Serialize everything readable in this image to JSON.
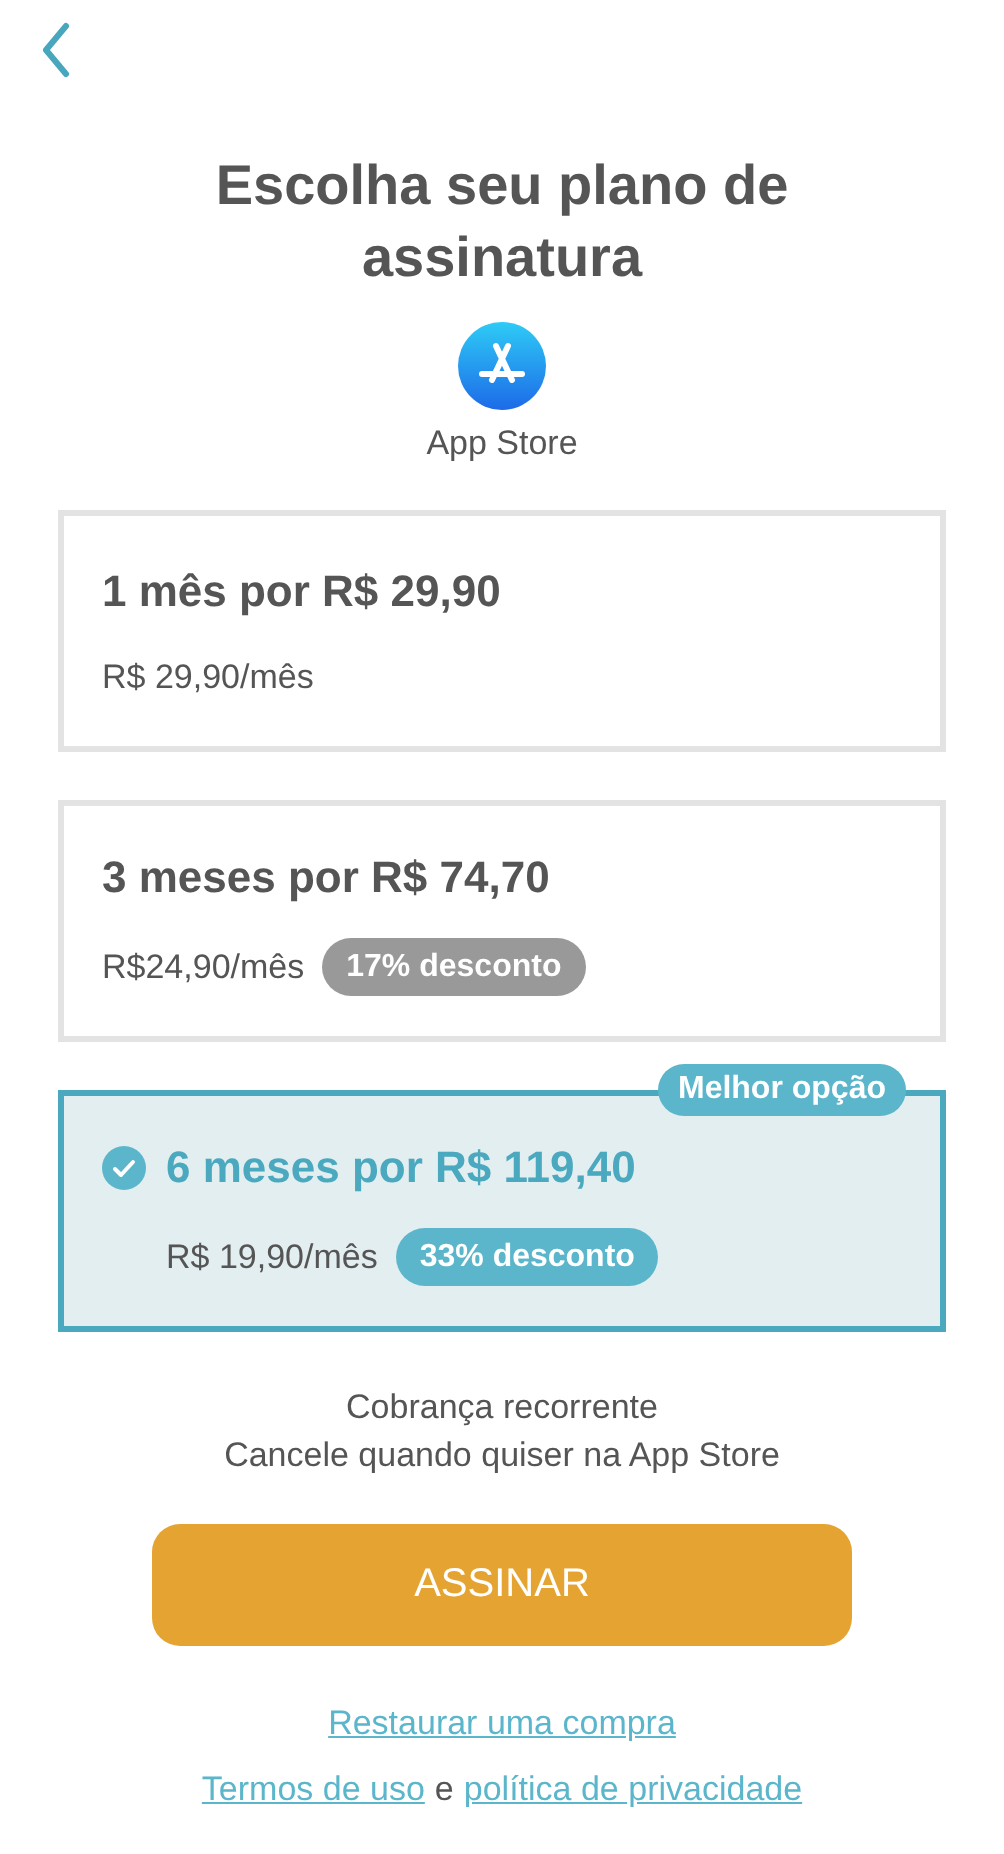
{
  "title": "Escolha seu plano de assinatura",
  "store": {
    "label": "App Store"
  },
  "plans": [
    {
      "title": "1 mês por R$ 29,90",
      "price": "R$ 29,90/mês",
      "selected": false
    },
    {
      "title": "3 meses por R$ 74,70",
      "price": "R$24,90/mês",
      "discount": "17% desconto",
      "selected": false
    },
    {
      "title": "6 meses por R$ 119,40",
      "price": "R$ 19,90/mês",
      "discount": "33% desconto",
      "badge": "Melhor opção",
      "selected": true
    }
  ],
  "notes": [
    "Cobrança recorrente",
    "Cancele quando quiser na App Store"
  ],
  "subscribe_button": "ASSINAR",
  "restore_link": "Restaurar uma compra",
  "legal": {
    "terms_link": "Termos de uso",
    "conjunction": "e",
    "privacy_link": "política de privacidade"
  }
}
